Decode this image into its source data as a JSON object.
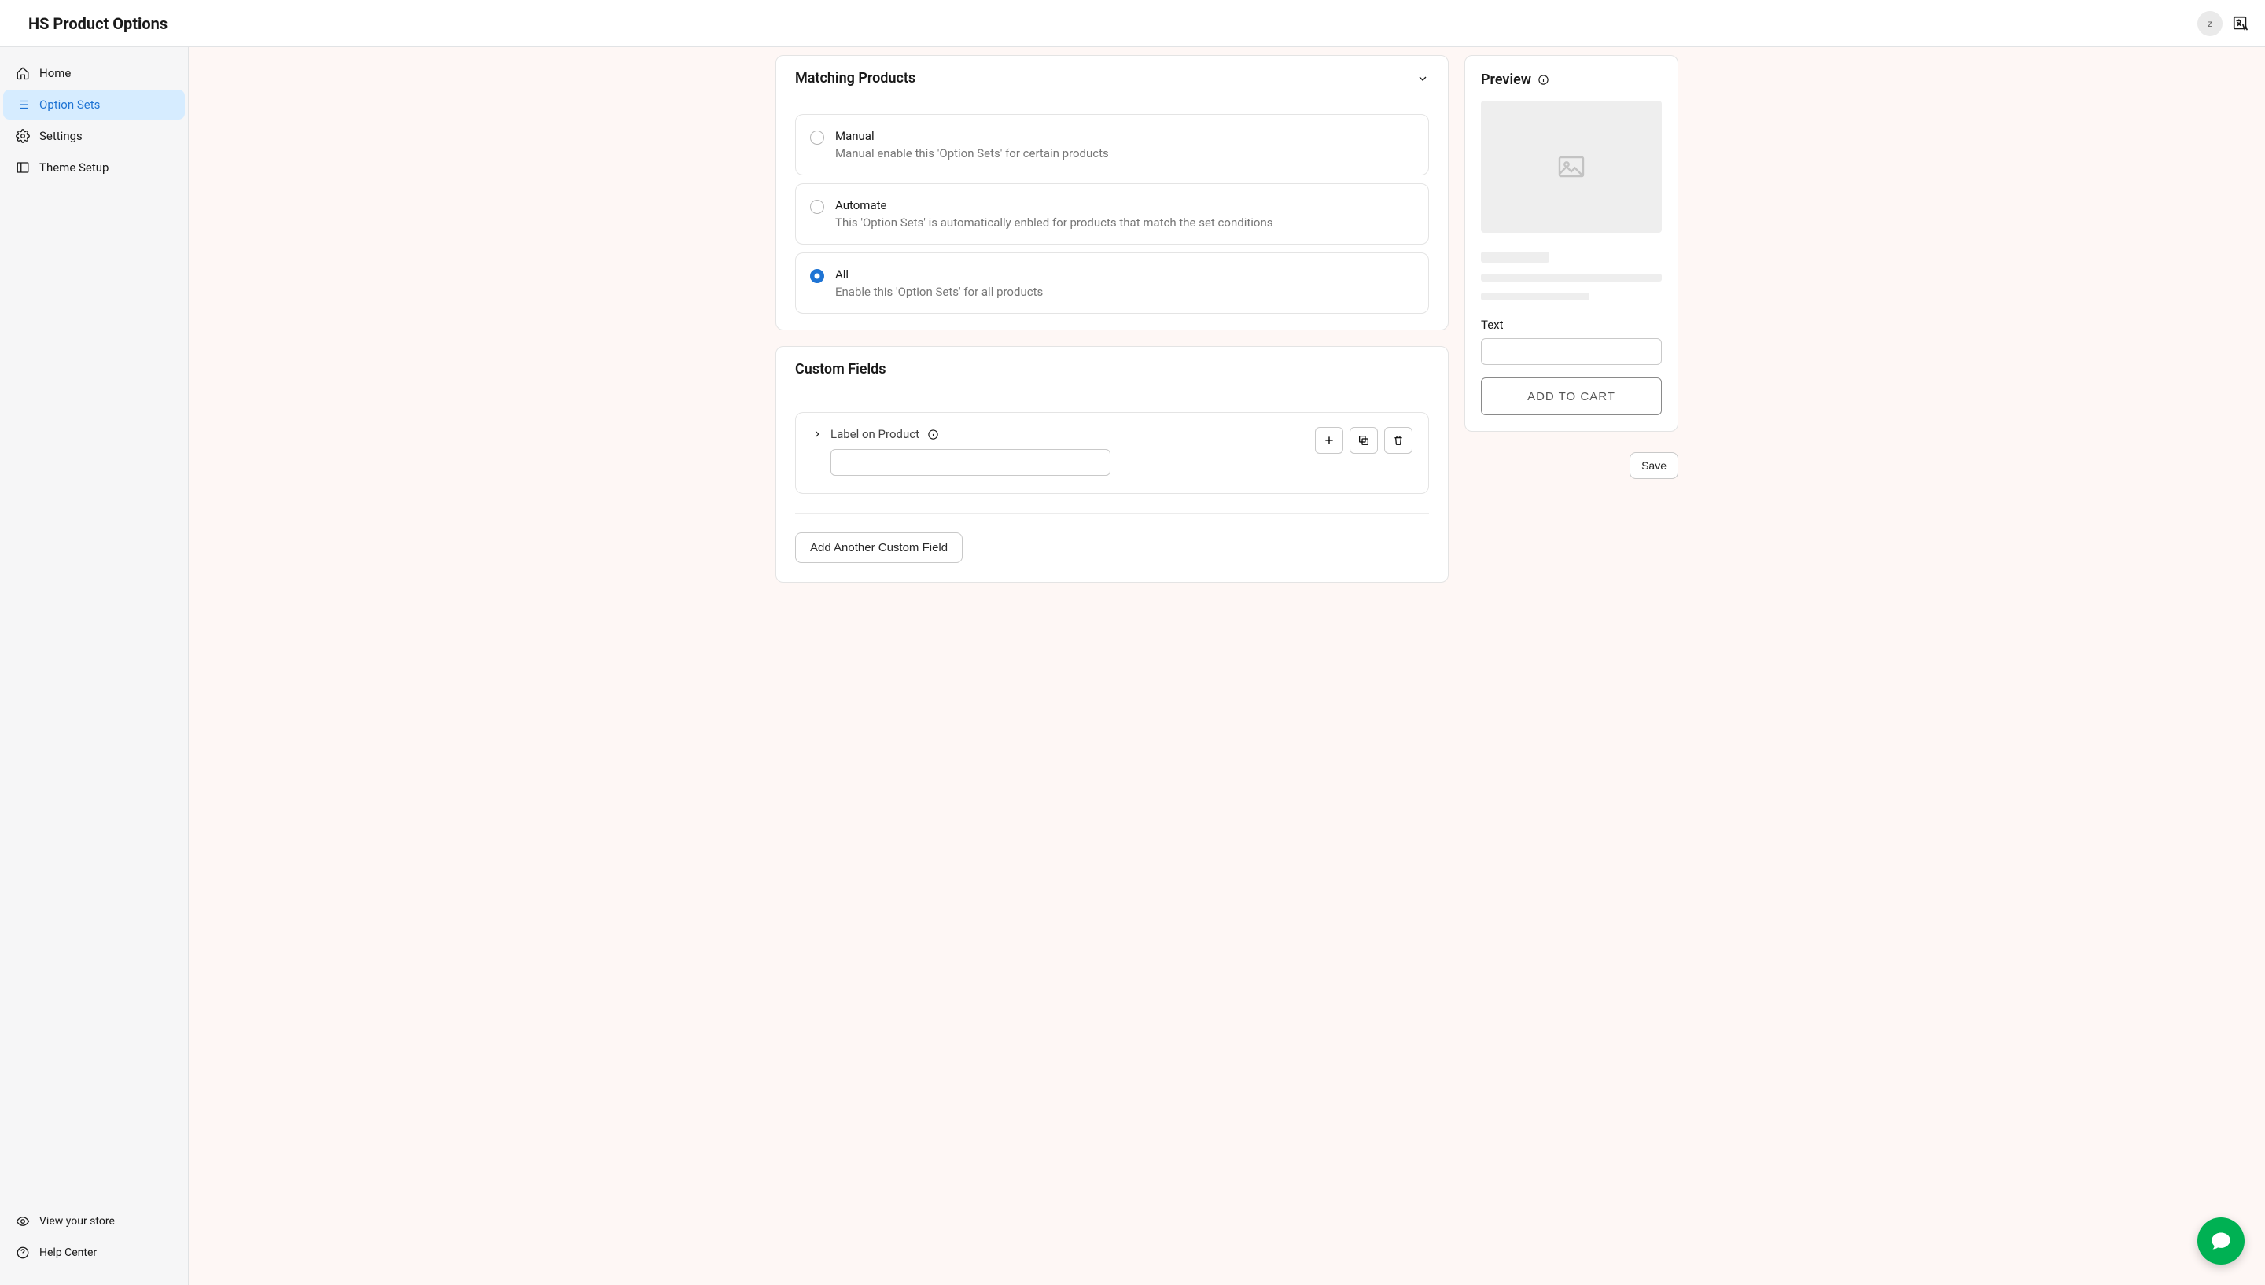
{
  "app_title": "HS Product Options",
  "avatar_initial": "z",
  "sidebar": {
    "items": [
      {
        "label": "Home"
      },
      {
        "label": "Option Sets"
      },
      {
        "label": "Settings"
      },
      {
        "label": "Theme Setup"
      }
    ],
    "footer": [
      {
        "label": "View your store"
      },
      {
        "label": "Help Center"
      }
    ]
  },
  "matching": {
    "title": "Matching Products",
    "options": [
      {
        "title": "Manual",
        "desc": "Manual enable this 'Option Sets' for certain products"
      },
      {
        "title": "Automate",
        "desc": "This 'Option Sets' is automatically enbled for products that match the set conditions"
      },
      {
        "title": "All",
        "desc": "Enable this 'Option Sets' for all products"
      }
    ],
    "selected_index": 2
  },
  "custom_fields": {
    "title": "Custom Fields",
    "fields": [
      {
        "label": "Label on Product",
        "value": ""
      }
    ],
    "add_button": "Add Another Custom Field"
  },
  "preview": {
    "title": "Preview",
    "text_label": "Text",
    "add_to_cart": "ADD TO CART"
  },
  "save_button": "Save"
}
